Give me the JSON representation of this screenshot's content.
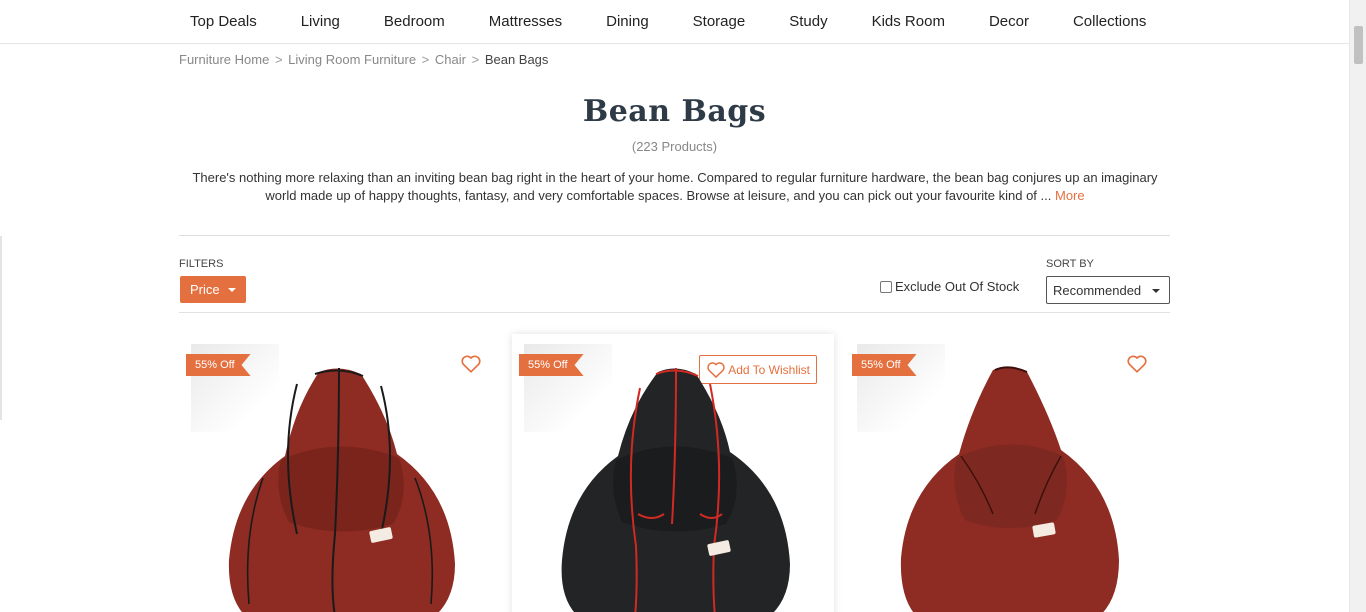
{
  "nav": {
    "items": [
      "Top Deals",
      "Living",
      "Bedroom",
      "Mattresses",
      "Dining",
      "Storage",
      "Study",
      "Kids Room",
      "Decor",
      "Collections"
    ]
  },
  "breadcrumb": {
    "items": [
      "Furniture Home",
      "Living Room Furniture",
      "Chair"
    ],
    "separator": ">",
    "current": "Bean Bags"
  },
  "page": {
    "title": "Bean Bags",
    "count": "(223 Products)",
    "description": "There's nothing more relaxing than an inviting bean bag right in the heart of your home. Compared to regular furniture hardware, the bean bag conjures up an imaginary world made up of happy thoughts, fantasy, and very comfortable spaces. Browse at leisure, and you can pick out your favourite kind of ...",
    "more_link": "More"
  },
  "filters": {
    "label": "FILTERS",
    "price_button": "Price",
    "exclude_label": "Exclude Out Of Stock",
    "exclude_checked": false,
    "sort_label": "SORT BY",
    "sort_value": "Recommended"
  },
  "products": [
    {
      "discount": "55% Off",
      "color": "maroon",
      "piping": "black",
      "hovered": false
    },
    {
      "discount": "55% Off",
      "color": "black",
      "piping": "red",
      "hovered": true,
      "wishlist_label": "Add To Wishlist"
    },
    {
      "discount": "55% Off",
      "color": "maroon",
      "piping": "maroon",
      "hovered": false
    }
  ],
  "colors": {
    "accent": "#e5703f",
    "title": "#2e3b47",
    "maroon": "#8e2b22",
    "black": "#222426",
    "red_piping": "#d22a22"
  }
}
